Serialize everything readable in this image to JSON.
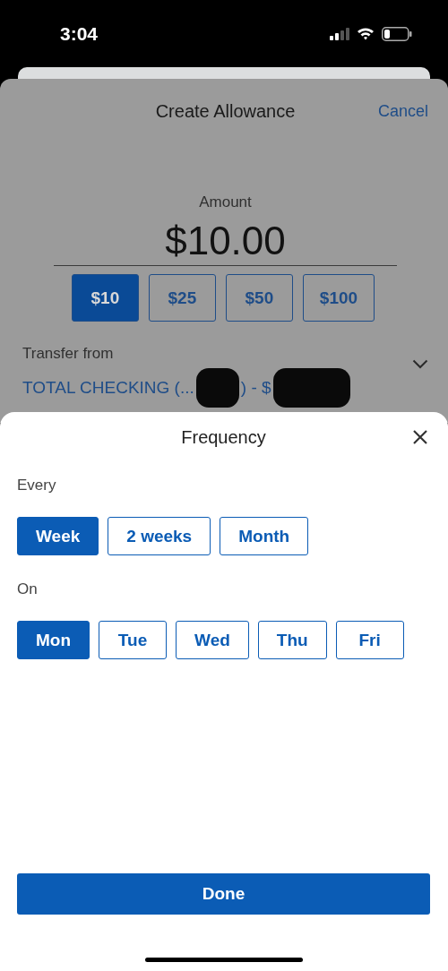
{
  "status_bar": {
    "time": "3:04"
  },
  "background_screen": {
    "title": "Create Allowance",
    "cancel": "Cancel",
    "amount_label": "Amount",
    "amount": "$10.00",
    "presets": [
      {
        "label": "$10",
        "selected": true
      },
      {
        "label": "$25",
        "selected": false
      },
      {
        "label": "$50",
        "selected": false
      },
      {
        "label": "$100",
        "selected": false
      }
    ],
    "transfer_label": "Transfer from",
    "account_parts": [
      "TOTAL CHECKING (...",
      ") - $"
    ]
  },
  "frequency_sheet": {
    "title": "Frequency",
    "every_label": "Every",
    "periods": [
      {
        "label": "Week",
        "selected": true
      },
      {
        "label": "2 weeks",
        "selected": false
      },
      {
        "label": "Month",
        "selected": false
      }
    ],
    "on_label": "On",
    "days": [
      {
        "label": "Mon",
        "selected": true
      },
      {
        "label": "Tue",
        "selected": false
      },
      {
        "label": "Wed",
        "selected": false
      },
      {
        "label": "Thu",
        "selected": false
      },
      {
        "label": "Fri",
        "selected": false
      }
    ],
    "done": "Done"
  }
}
